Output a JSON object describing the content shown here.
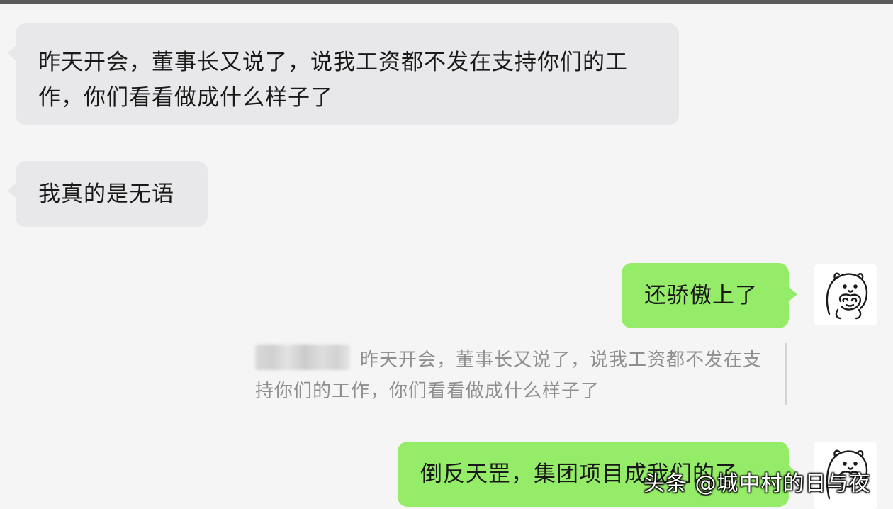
{
  "messages": [
    {
      "direction": "incoming",
      "text": "昨天开会，董事长又说了，说我工资都不发在支持你们的工作，你们看看做成什么样子了"
    },
    {
      "direction": "incoming",
      "text": "我真的是无语"
    },
    {
      "direction": "outgoing",
      "text": "还骄傲上了",
      "avatar_icon": "cartoon-bear-icon"
    },
    {
      "direction": "outgoing",
      "text": "倒反天罡，集团项目成我们的了",
      "avatar_icon": "cartoon-bear-icon"
    }
  ],
  "quote": {
    "text": "昨天开会，董事长又说了，说我工资都不发在支持你们的工作，你们看看做成什么样子了"
  },
  "watermark": {
    "text": "头条 @城中村的日与夜"
  },
  "colors": {
    "background": "#f5f5f5",
    "incoming_bubble": "#e8e8ea",
    "outgoing_bubble": "#95ec69",
    "quote_text": "#8f8f8f"
  }
}
